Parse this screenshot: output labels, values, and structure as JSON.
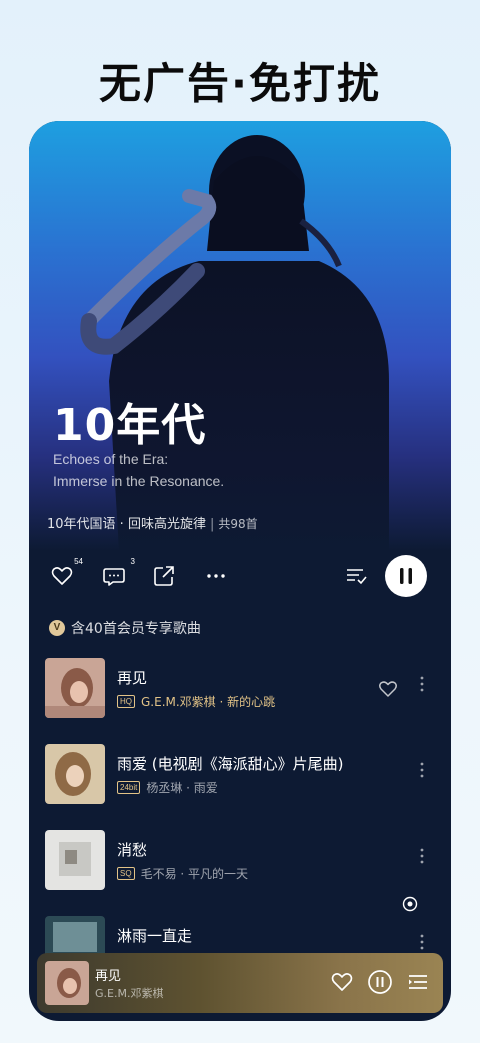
{
  "headline": "无广告·免打扰",
  "playlist": {
    "title": "10年代",
    "subtitle_line1": "Echoes of the Era:",
    "subtitle_line2": "Immerse in the Resonance.",
    "description": "10年代国语 · 回味高光旋律",
    "separator": "|",
    "song_count": "共98首"
  },
  "actions": {
    "like_count": "54",
    "comment_count": "3",
    "share_icon": "share-icon",
    "more_icon": "more-icon",
    "multi_select_icon": "multi-select-icon",
    "play_state": "pause"
  },
  "vip_notice": {
    "icon": "V",
    "text": "含40首会员专享歌曲"
  },
  "songs": [
    {
      "title": "再见",
      "quality": "HQ",
      "subtitle": "G.E.M.邓紫棋 · 新的心跳",
      "highlighted": true,
      "liked_icon": "heart-outline-icon"
    },
    {
      "title": "雨爱 (电视剧《海派甜心》片尾曲)",
      "quality": "24bit",
      "subtitle": "杨丞琳 · 雨爱",
      "highlighted": false
    },
    {
      "title": "消愁",
      "quality": "SQ",
      "subtitle": "毛不易 · 平凡的一天",
      "highlighted": false
    },
    {
      "title": "淋雨一直走",
      "quality": "",
      "subtitle": "",
      "highlighted": false
    }
  ],
  "now_playing": {
    "title": "再见",
    "artist": "G.E.M.邓紫棋"
  },
  "colors": {
    "panel_bg": "#0d1a33",
    "gold_accent": "#e2c387",
    "headline_text": "#0b0b0b"
  }
}
